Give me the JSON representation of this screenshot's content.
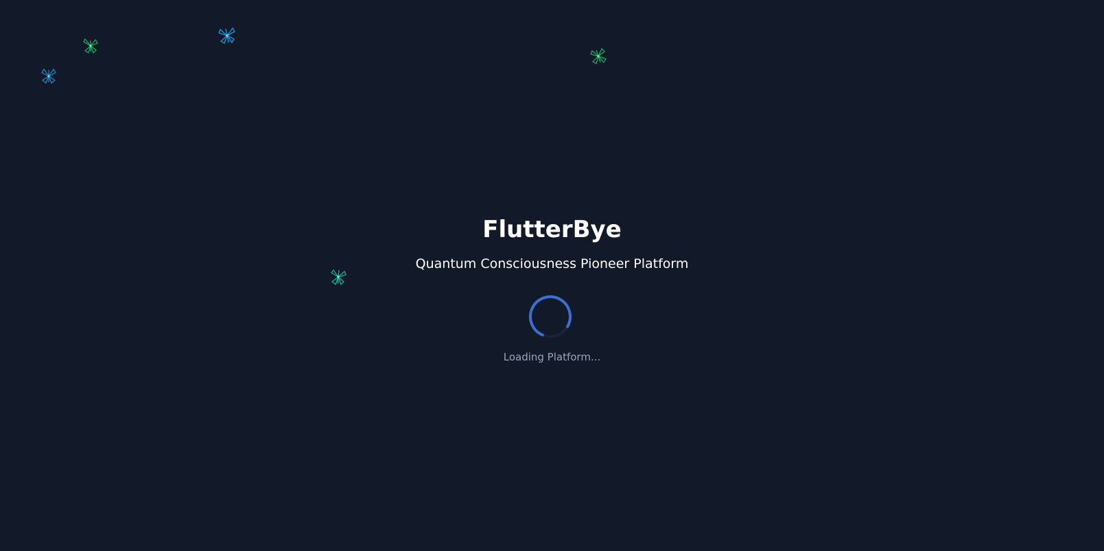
{
  "app": {
    "title": "FlutterBye",
    "subtitle": "Quantum Consciousness Pioneer Platform",
    "loading_text": "Loading Platform..."
  },
  "colors": {
    "background": "#121929",
    "spinner": "#3b6fd1",
    "butterfly_blue": "#1aa3e8",
    "butterfly_green": "#1fc46b",
    "butterfly_teal": "#19c9a8"
  },
  "decorations": {
    "butterflies": [
      {
        "name": "butterfly-icon",
        "color": "butterfly_green"
      },
      {
        "name": "butterfly-icon",
        "color": "butterfly_blue"
      },
      {
        "name": "butterfly-icon",
        "color": "butterfly_blue"
      },
      {
        "name": "butterfly-icon",
        "color": "butterfly_green"
      },
      {
        "name": "butterfly-icon",
        "color": "butterfly_teal"
      }
    ]
  }
}
